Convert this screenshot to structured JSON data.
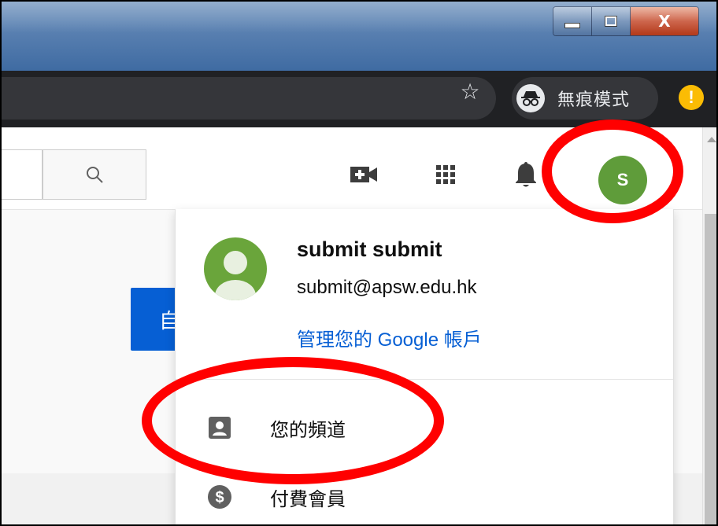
{
  "window": {
    "minimize_label": "",
    "maximize_label": "",
    "close_label": "X"
  },
  "toolbar": {
    "incognito_label": "無痕模式",
    "warning_glyph": "!"
  },
  "masthead": {
    "avatar_initial": "S"
  },
  "page": {
    "primary_button_partial": "自"
  },
  "account_menu": {
    "name": "submit submit",
    "email": "submit@apsw.edu.hk",
    "manage_link": "管理您的 Google 帳戶",
    "items": [
      {
        "label": "您的頻道",
        "icon": "account-box-icon"
      },
      {
        "label": "付費會員",
        "icon": "dollar-circle-icon"
      }
    ]
  },
  "colors": {
    "annotation": "#ff0000",
    "avatar": "#5f9c3a",
    "link": "#065fd4"
  }
}
